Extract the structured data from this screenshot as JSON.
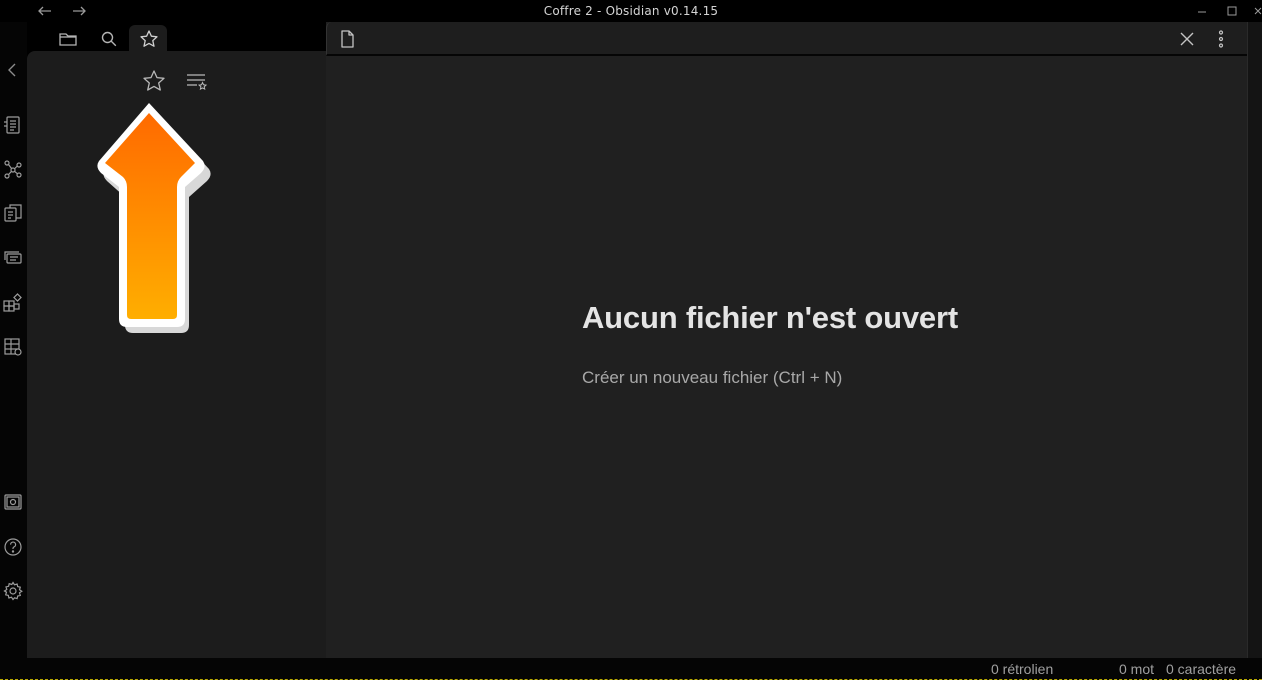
{
  "window": {
    "title": "Coffre 2 - Obsidian v0.14.15"
  },
  "ribbon": {
    "top_icons": [
      "chevron-left-icon",
      "outline-icon",
      "graph-icon",
      "copy-icon",
      "cards-icon",
      "dataview-icon",
      "table-icon"
    ],
    "bottom_icons": [
      "vault-icon",
      "help-icon",
      "settings-icon"
    ]
  },
  "sidebar": {
    "tabs": [
      "folder-icon",
      "search-icon",
      "star-icon"
    ],
    "active_tab": "star-icon",
    "actions": [
      "star-outline-icon",
      "sort-list-icon"
    ]
  },
  "pane": {
    "header_icons": [
      "file-icon",
      "close-icon",
      "more-options-icon"
    ],
    "empty_title": "Aucun fichier n'est ouvert",
    "empty_action": "Créer un nouveau fichier (Ctrl + N)"
  },
  "status": {
    "backlinks": "0 rétrolien",
    "words": "0 mot",
    "chars": "0 caractère"
  },
  "colors": {
    "background": "#000000",
    "sidebar": "#1c1c1c",
    "pane": "#202020",
    "arrow_top": "#ff6a00",
    "arrow_bottom": "#ffae00"
  }
}
